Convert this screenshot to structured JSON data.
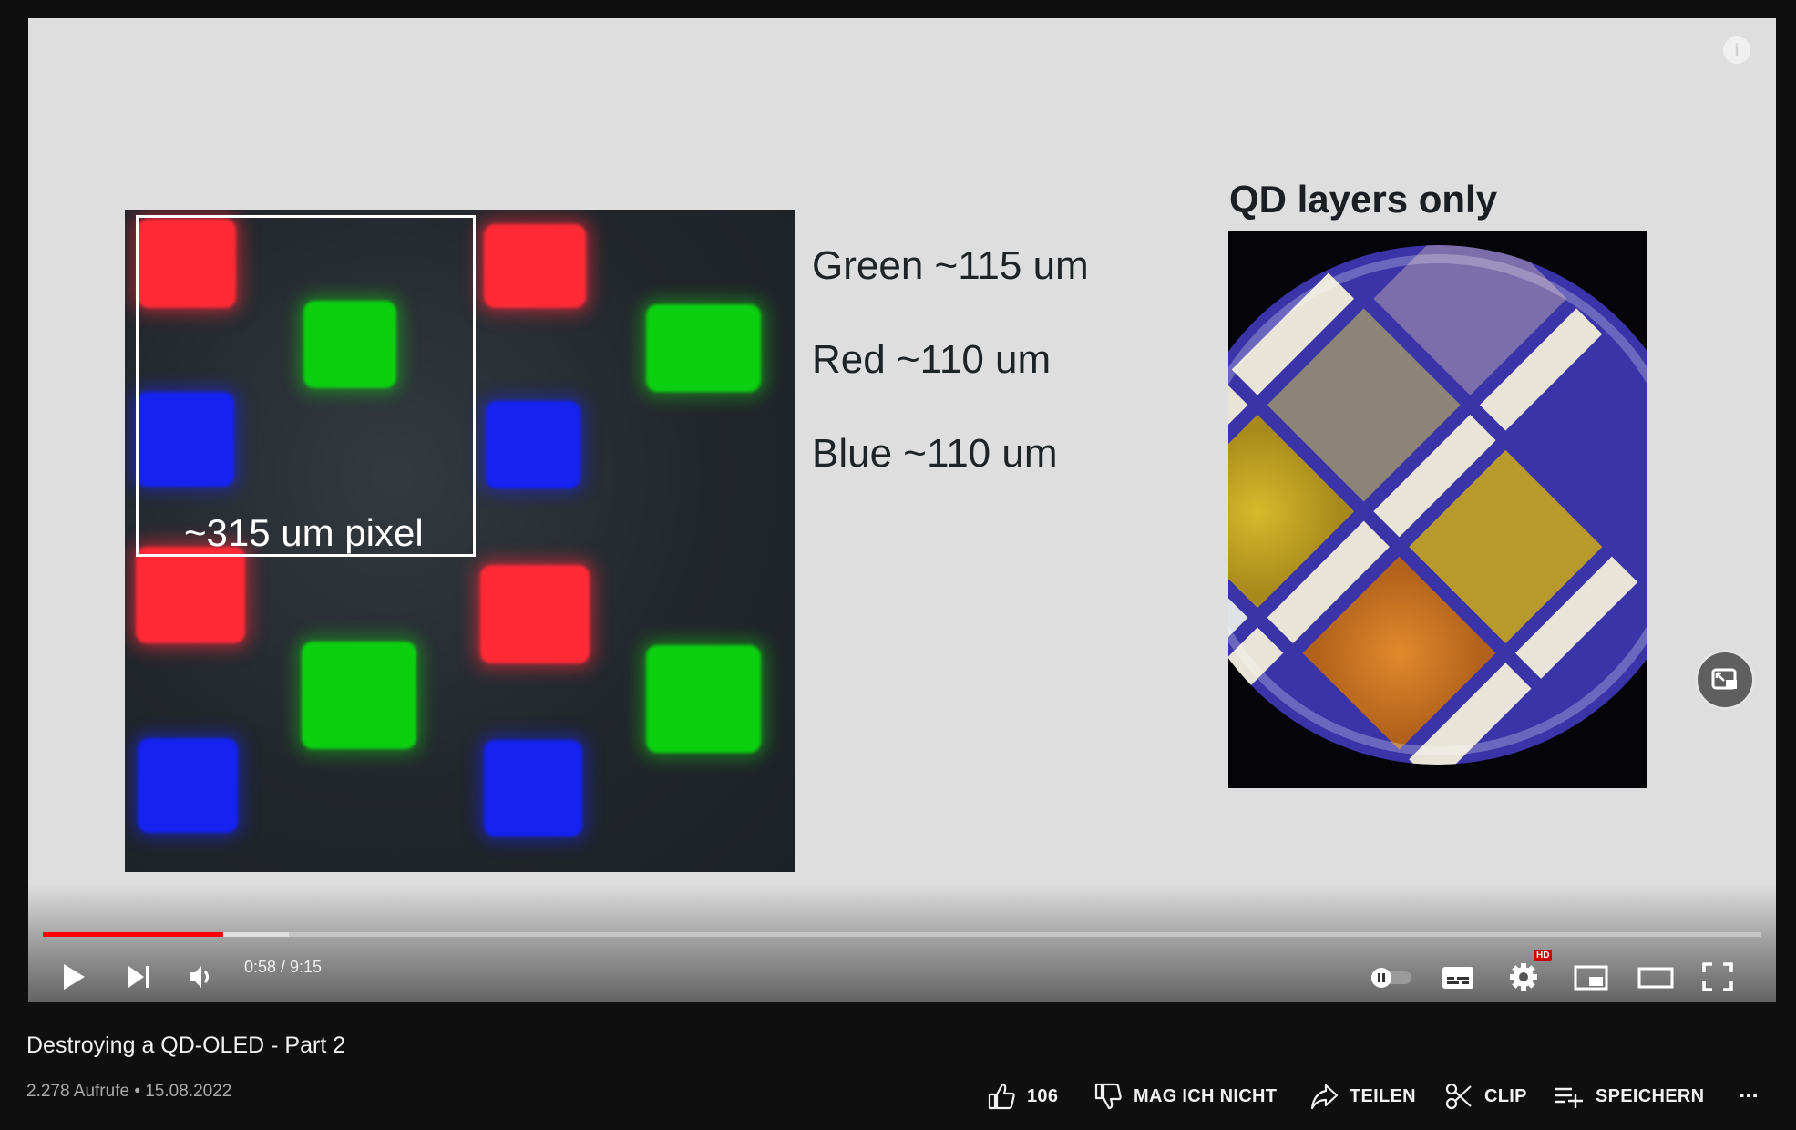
{
  "slide": {
    "pixel_label": "~315 um pixel",
    "specs": [
      "Green ~115 um",
      "Red ~110 um",
      "Blue ~110 um"
    ],
    "qd_title": "QD layers only"
  },
  "player": {
    "current_time": "0:58",
    "duration": "9:15",
    "time_display": "0:58 / 9:15",
    "progress_fraction": 0.105,
    "buffer_fraction": 0.143,
    "settings_badge": "HD",
    "accent_color": "#ff0000",
    "icons": [
      "play-icon",
      "next-icon",
      "volume-icon",
      "autoplay-toggle",
      "subtitles-icon",
      "settings-icon",
      "miniplayer-icon",
      "theater-icon",
      "fullscreen-icon"
    ]
  },
  "video": {
    "title": "Destroying a QD-OLED - Part 2",
    "meta": "2.278 Aufrufe • 15.08.2022"
  },
  "actions": {
    "like_count": "106",
    "dislike_label": "MAG ICH NICHT",
    "share_label": "TEILEN",
    "clip_label": "CLIP",
    "save_label": "SPEICHERN",
    "more_label": "..."
  }
}
